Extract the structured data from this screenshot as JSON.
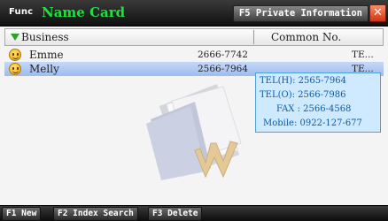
{
  "titlebar": {
    "func_label": "Func",
    "app_title": "Name Card",
    "f5_label": "F5 Private Information",
    "close_glyph": "✕"
  },
  "columns": {
    "business": "Business",
    "common": "Common No."
  },
  "rows": [
    {
      "name": "Emme",
      "phone": "2666-7742",
      "tel": "TE...",
      "icon": "smiley-icon"
    },
    {
      "name": "Melly",
      "phone": "2566-7964",
      "tel": "TE...",
      "icon": "smiley-icon"
    }
  ],
  "popup": {
    "line1": "TEL(H): 2565-7964",
    "line2": "TEL(O): 2566-7986",
    "line3": "FAX : 2566-4568",
    "line4": "Mobile: 0922-127-677"
  },
  "toolbar": {
    "f1": "F1 New",
    "f2": "F2 Index Search",
    "f3": "F3 Delete"
  },
  "colors": {
    "title_green": "#20e040",
    "popup_text": "#0a5ab0",
    "popup_bg": "#cfeaff",
    "close_red": "#d03414"
  }
}
